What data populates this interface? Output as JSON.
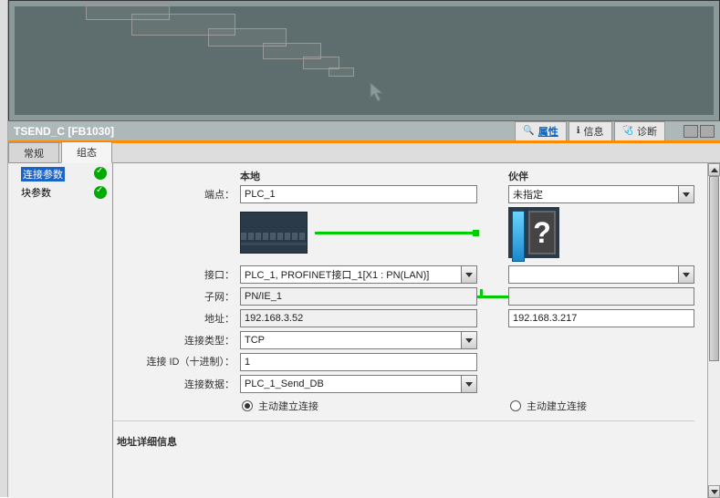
{
  "titleBar": {
    "title": "TSEND_C [FB1030]",
    "tabs": {
      "properties": "属性",
      "info": "信息",
      "diagnostics": "诊断"
    }
  },
  "mainTabs": {
    "general": "常规",
    "configuration": "组态"
  },
  "sidebar": {
    "items": [
      {
        "label": "连接参数",
        "selected": true
      },
      {
        "label": "块参数",
        "selected": false
      }
    ]
  },
  "columns": {
    "local": "本地",
    "partner": "伙伴"
  },
  "labels": {
    "endpoint": "端点：",
    "interface": "接口：",
    "subnet": "子网：",
    "address": "地址：",
    "connType": "连接类型：",
    "connId": "连接 ID（十进制）：",
    "connData": "连接数据：",
    "activeConn": "主动建立连接",
    "section2": "地址详细信息"
  },
  "values": {
    "endpoint_local": "PLC_1",
    "endpoint_partner": "未指定",
    "interface_local": "PLC_1, PROFINET接口_1[X1 : PN(LAN)]",
    "interface_partner": "",
    "subnet_local": "PN/IE_1",
    "subnet_partner": "",
    "address_local": "192.168.3.52",
    "address_partner": "192.168.3.217",
    "connType": "TCP",
    "connId": "1",
    "connData": "PLC_1_Send_DB",
    "activeLocal": true,
    "activePartner": false
  }
}
